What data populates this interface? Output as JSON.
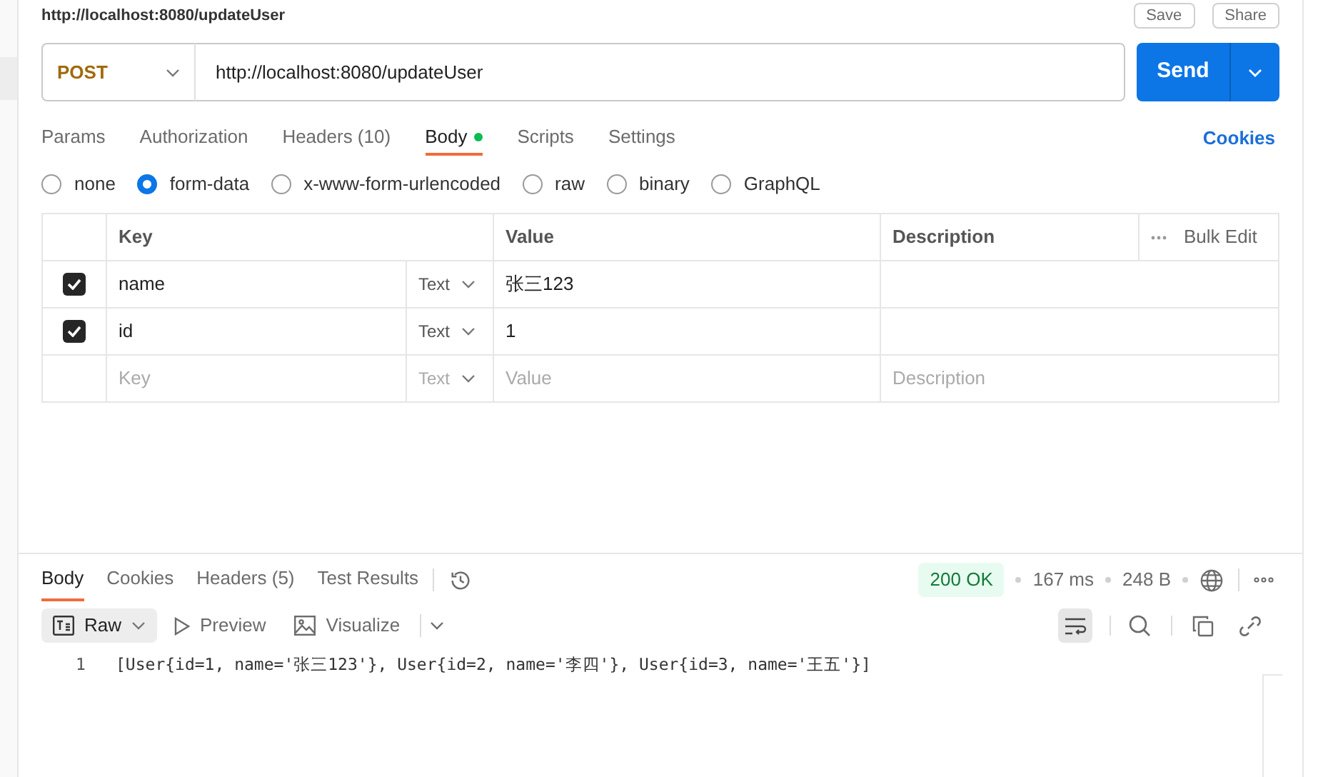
{
  "header": {
    "title": "http://localhost:8080/updateUser",
    "save": "Save",
    "share": "Share"
  },
  "request": {
    "method": "POST",
    "url": "http://localhost:8080/updateUser",
    "send": "Send"
  },
  "tabs": [
    {
      "label": "Params",
      "selected": false,
      "dot": false
    },
    {
      "label": "Authorization",
      "selected": false,
      "dot": false
    },
    {
      "label": "Headers (10)",
      "selected": false,
      "dot": false
    },
    {
      "label": "Body",
      "selected": true,
      "dot": true
    },
    {
      "label": "Scripts",
      "selected": false,
      "dot": false
    },
    {
      "label": "Settings",
      "selected": false,
      "dot": false
    }
  ],
  "cookies_link": "Cookies",
  "body_types": [
    {
      "label": "none",
      "selected": false
    },
    {
      "label": "form-data",
      "selected": true
    },
    {
      "label": "x-www-form-urlencoded",
      "selected": false
    },
    {
      "label": "raw",
      "selected": false
    },
    {
      "label": "binary",
      "selected": false
    },
    {
      "label": "GraphQL",
      "selected": false
    }
  ],
  "table": {
    "columns": [
      "Key",
      "Value",
      "Description"
    ],
    "bulk_edit": "Bulk Edit",
    "rows": [
      {
        "checked": true,
        "key": "name",
        "type": "Text",
        "value": "张三123",
        "description": ""
      },
      {
        "checked": true,
        "key": "id",
        "type": "Text",
        "value": "1",
        "description": ""
      }
    ],
    "new_row": {
      "key": "Key",
      "type": "Text",
      "value": "Value",
      "description": "Description"
    }
  },
  "response": {
    "tabs": [
      {
        "label": "Body",
        "selected": true
      },
      {
        "label": "Cookies",
        "selected": false
      },
      {
        "label": "Headers (5)",
        "selected": false
      },
      {
        "label": "Test Results",
        "selected": false
      }
    ],
    "status": "200 OK",
    "time": "167 ms",
    "size": "248 B",
    "views": [
      {
        "label": "Raw",
        "selected": true
      },
      {
        "label": "Preview",
        "selected": false
      },
      {
        "label": "Visualize",
        "selected": false
      }
    ],
    "lines": [
      {
        "number": "1",
        "text": "[User{id=1, name='张三123'}, User{id=2, name='李四'}, User{id=3, name='王五'}]"
      }
    ]
  }
}
